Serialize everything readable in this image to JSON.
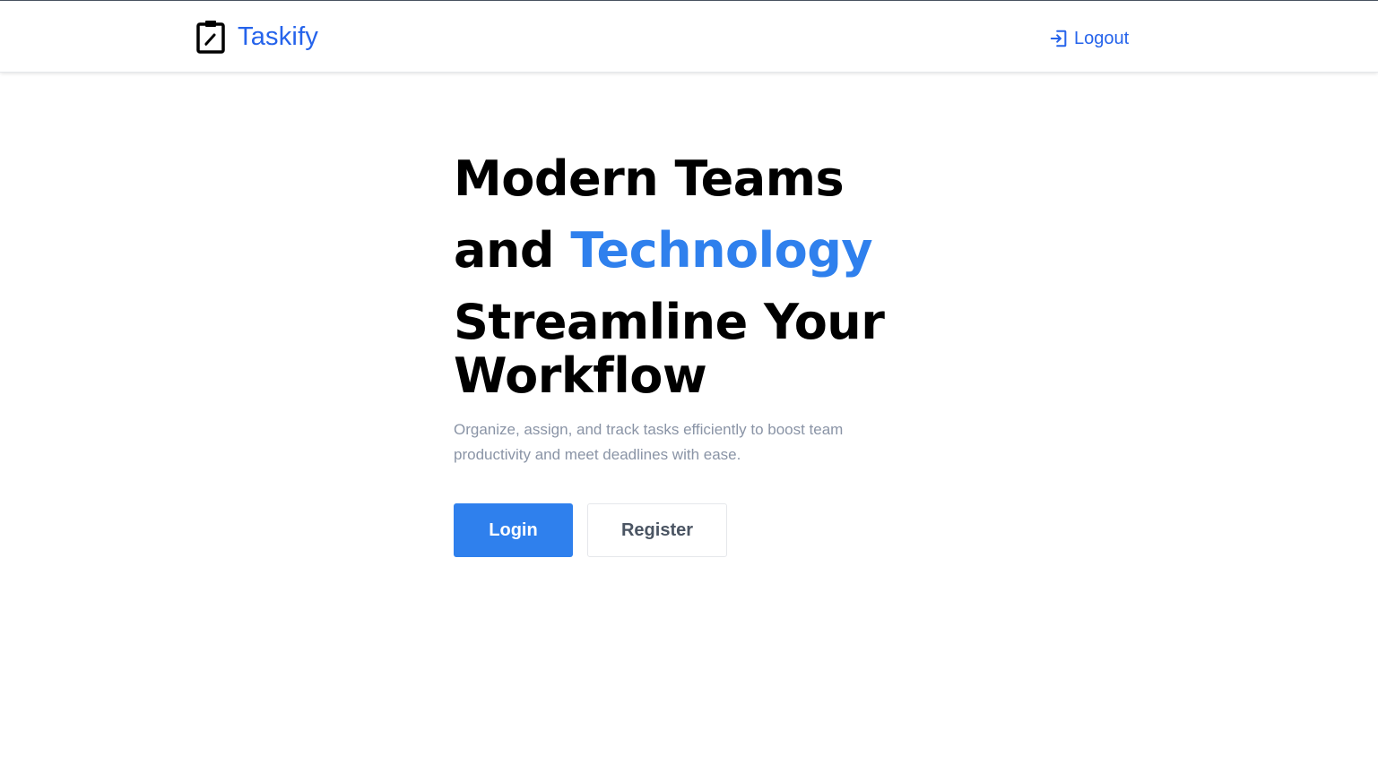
{
  "header": {
    "brand_name": "Taskify",
    "logout_label": "Logout"
  },
  "hero": {
    "title_line1": "Modern Teams",
    "title_line2_prefix": "and ",
    "title_line2_accent": "Technology",
    "title_line3": "Streamline Your",
    "title_line4": "Workflow",
    "subtitle": "Organize, assign, and track tasks efficiently to boost team productivity and meet deadlines with ease.",
    "login_label": "Login",
    "register_label": "Register"
  },
  "colors": {
    "brand": "#2563eb",
    "accent": "#2f80ed",
    "subtitle": "#8a94a6",
    "heading": "#000000"
  },
  "icons": {
    "brand": "clipboard-edit-icon",
    "logout": "sign-in-arrow-icon"
  }
}
